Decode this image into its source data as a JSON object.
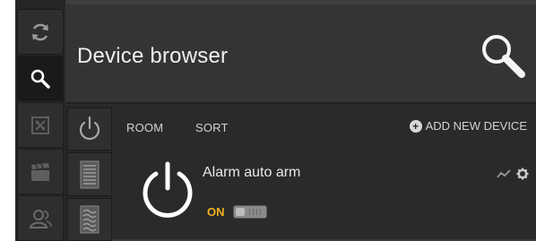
{
  "header": {
    "title": "Device browser"
  },
  "rail": {
    "items": [
      {
        "icon": "sync-icon",
        "active": false
      },
      {
        "icon": "search-icon",
        "active": true
      },
      {
        "icon": "frame-icon",
        "active": false
      },
      {
        "icon": "clapperboard-icon",
        "active": false
      },
      {
        "icon": "users-icon",
        "active": false
      }
    ]
  },
  "subrail": {
    "items": [
      {
        "icon": "power-icon"
      },
      {
        "icon": "list-icon"
      },
      {
        "icon": "waves-icon"
      }
    ]
  },
  "toolbar": {
    "room_label": "ROOM",
    "sort_label": "SORT",
    "add_label": "ADD NEW DEVICE"
  },
  "devices": [
    {
      "name": "Alarm auto arm",
      "status": "ON",
      "enabled": true
    }
  ],
  "colors": {
    "accent": "#f2b21c",
    "background": "#2c2c2c"
  }
}
